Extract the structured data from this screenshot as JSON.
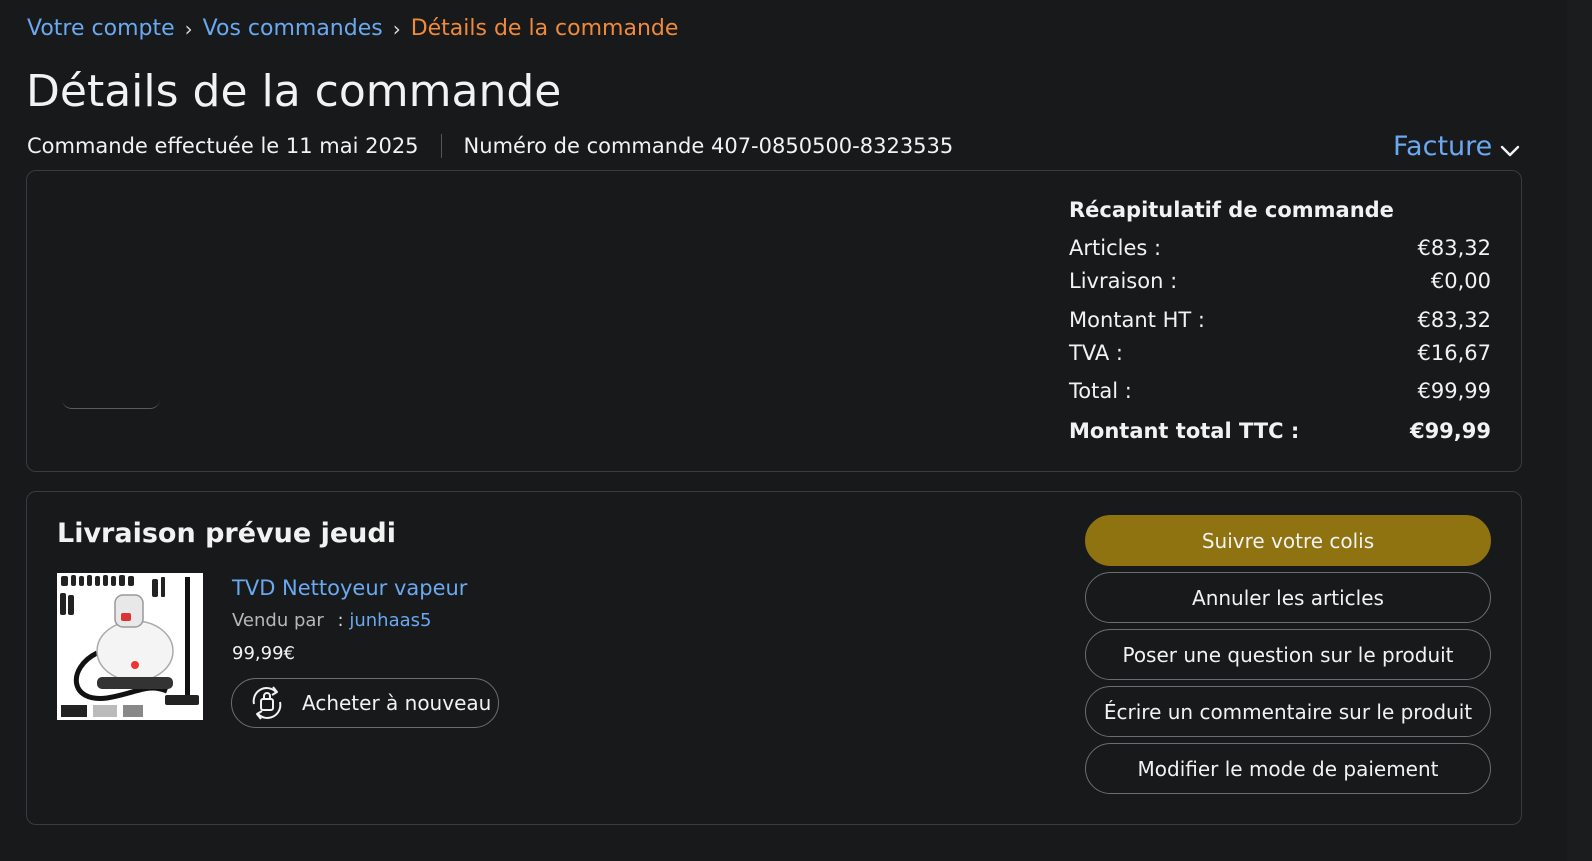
{
  "breadcrumb": {
    "account": "Votre compte",
    "orders": "Vos commandes",
    "current": "Détails de la commande",
    "separator": "›"
  },
  "page_title": "Détails de la commande",
  "order_meta": {
    "date": "Commande effectuée le 11 mai 2025",
    "number": "Numéro de commande 407-0850500-8323535"
  },
  "invoice": {
    "label": "Facture",
    "icon": "chevron-down-icon"
  },
  "summary": {
    "heading": "Récapitulatif de commande",
    "rows": [
      {
        "label": "Articles :",
        "value": "€83,32"
      },
      {
        "label": "Livraison :",
        "value": "€0,00"
      },
      {
        "label": "Montant HT :",
        "value": "€83,32"
      },
      {
        "label": "TVA :",
        "value": "€16,67"
      },
      {
        "label": "Total :",
        "value": "€99,99"
      },
      {
        "label": "Montant total TTC :",
        "value": "€99,99"
      }
    ]
  },
  "delivery": {
    "heading": "Livraison prévue jeudi",
    "product": {
      "title": "TVD Nettoyeur vapeur",
      "sold_by_label": "Vendu par",
      "sold_by_colon": ":",
      "seller": "junhaas5",
      "price": "99,99€",
      "buy_again": "Acheter à nouveau",
      "image_icon": "steam-cleaner-product-image"
    },
    "actions": {
      "track": "Suivre votre colis",
      "cancel": "Annuler les articles",
      "question": "Poser une question sur le produit",
      "review": "Écrire un commentaire sur le produit",
      "payment": "Modifier le mode de paiement"
    }
  },
  "colors": {
    "background": "#18191b",
    "link": "#6aa8f0",
    "breadcrumb_current": "#f08a3a",
    "primary_button": "#8e7310",
    "border": "#3a3b3e"
  }
}
